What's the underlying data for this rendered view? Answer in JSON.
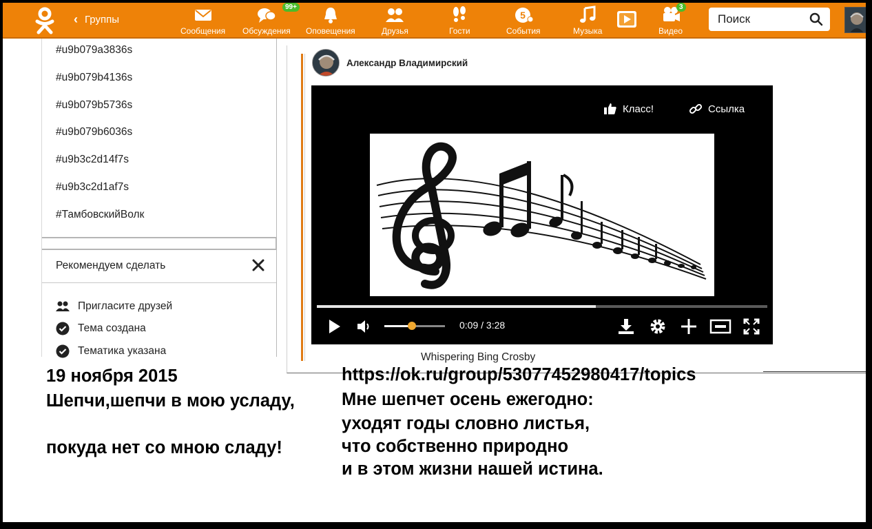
{
  "nav": {
    "back_label": "Группы",
    "items": [
      {
        "key": "messages",
        "label": "Сообщения",
        "icon": "envelope-icon"
      },
      {
        "key": "discussions",
        "label": "Обсуждения",
        "icon": "chat-bubbles-icon",
        "badge": "99+"
      },
      {
        "key": "notifications",
        "label": "Оповещения",
        "icon": "bell-icon"
      },
      {
        "key": "friends",
        "label": "Друзья",
        "icon": "friends-icon"
      },
      {
        "key": "guests",
        "label": "Гости",
        "icon": "footprints-icon"
      },
      {
        "key": "events",
        "label": "События",
        "icon": "events-5-icon"
      },
      {
        "key": "music",
        "label": "Музыка",
        "icon": "music-note-icon"
      },
      {
        "key": "video",
        "label": "Видео",
        "icon": "video-camera-icon",
        "badge": "3"
      }
    ],
    "search_placeholder": "Поиск"
  },
  "tags": [
    "#u9b079a3836s",
    "#u9b079b4136s",
    "#u9b079b5736s",
    "#u9b079b6036s",
    "#u9b3c2d14f7s",
    "#u9b3c2d1af7s",
    "#ТамбовскийВолк"
  ],
  "recommend": {
    "title": "Рекомендуем сделать",
    "items": [
      {
        "label": "Пригласите друзей",
        "icon": "invite-friends-icon"
      },
      {
        "label": "Тема создана",
        "icon": "check-circle-icon"
      },
      {
        "label": "Тематика указана",
        "icon": "check-circle-icon"
      }
    ]
  },
  "post": {
    "author": "Александр Владимирский",
    "video": {
      "like_label": "Класс!",
      "link_label": "Ссылка",
      "time": "0:09 / 3:28",
      "progress": 0.62,
      "volume": 0.45
    },
    "caption": "Whispering Bing Crosby"
  },
  "overlay": {
    "date": "19 ноября 2015",
    "left_lines": [
      "Шепчи,шепчи в мою усладу,",
      "покуда нет со мною сладу!"
    ],
    "url": "https://ok.ru/group/53077452980417/topics",
    "right_lines": [
      "Мне шепчет осень ежегодно:",
      "уходят годы словно листья,",
      "что собственно природно",
      "и в этом жизни нашей истина."
    ]
  },
  "colors": {
    "brand": "#ee8208",
    "badge": "#4bbb2a",
    "accent_line": "#e07b14"
  }
}
